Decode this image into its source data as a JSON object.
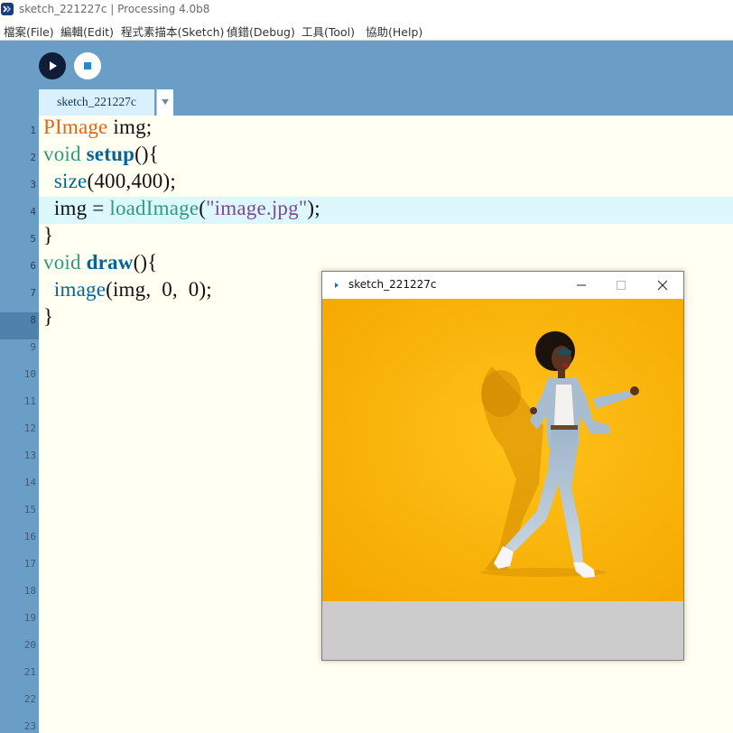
{
  "window": {
    "title": "sketch_221227c | Processing 4.0b8",
    "app_icon": "processing-app-icon"
  },
  "menu": {
    "items": [
      "檔案(File)",
      "編輯(Edit)",
      "程式素描本(Sketch)",
      "偵錯(Debug)",
      "工具(Tool)",
      "協助(Help)"
    ]
  },
  "toolbar": {
    "run_icon": "play-icon",
    "stop_icon": "stop-icon",
    "tab_label": "sketch_221227c",
    "tab_menu_icon": "chevron-down-icon"
  },
  "editor": {
    "current_line": 4,
    "line_numbers": [
      "1",
      "2",
      "3",
      "4",
      "5",
      "6",
      "7",
      "8",
      "9",
      "10",
      "11",
      "12",
      "13",
      "14",
      "15",
      "16",
      "17",
      "18",
      "19",
      "20",
      "21",
      "22",
      "23"
    ],
    "code": [
      [
        {
          "t": "PImage",
          "c": "kw-type"
        },
        {
          "t": " img;",
          "c": ""
        }
      ],
      [
        {
          "t": "void",
          "c": "kw-void"
        },
        {
          "t": " ",
          "c": ""
        },
        {
          "t": "setup",
          "c": "kw-func"
        },
        {
          "t": "(){",
          "c": ""
        }
      ],
      [
        {
          "t": "  ",
          "c": ""
        },
        {
          "t": "size",
          "c": "kw-call"
        },
        {
          "t": "(400,400);",
          "c": ""
        }
      ],
      [
        {
          "t": "  img = ",
          "c": ""
        },
        {
          "t": "loadImage",
          "c": "kw-load"
        },
        {
          "t": "(",
          "c": ""
        },
        {
          "t": "\"image.jpg\"",
          "c": "str"
        },
        {
          "t": ");",
          "c": ""
        }
      ],
      [
        {
          "t": "}",
          "c": ""
        }
      ],
      [
        {
          "t": "void",
          "c": "kw-void"
        },
        {
          "t": " ",
          "c": ""
        },
        {
          "t": "draw",
          "c": "kw-func"
        },
        {
          "t": "(){",
          "c": ""
        }
      ],
      [
        {
          "t": "  ",
          "c": ""
        },
        {
          "t": "image",
          "c": "kw-call"
        },
        {
          "t": "(img,  0,  0);",
          "c": ""
        }
      ],
      [
        {
          "t": "}",
          "c": ""
        }
      ]
    ]
  },
  "sketch_window": {
    "title": "sketch_221227c",
    "minimize_icon": "minimize-icon",
    "maximize_icon": "maximize-icon",
    "close_icon": "close-icon",
    "canvas_bg": "#fbb305",
    "photo_subject": "dancing-woman-photo"
  },
  "colors": {
    "toolbar_blue": "#6a9ec7",
    "editor_bg": "#fffff2",
    "current_line_bg": "#dcf8fd",
    "keyword_orange": "#e2661a",
    "keyword_green": "#33997e",
    "keyword_blue": "#006699",
    "string_purple": "#7d4793"
  }
}
